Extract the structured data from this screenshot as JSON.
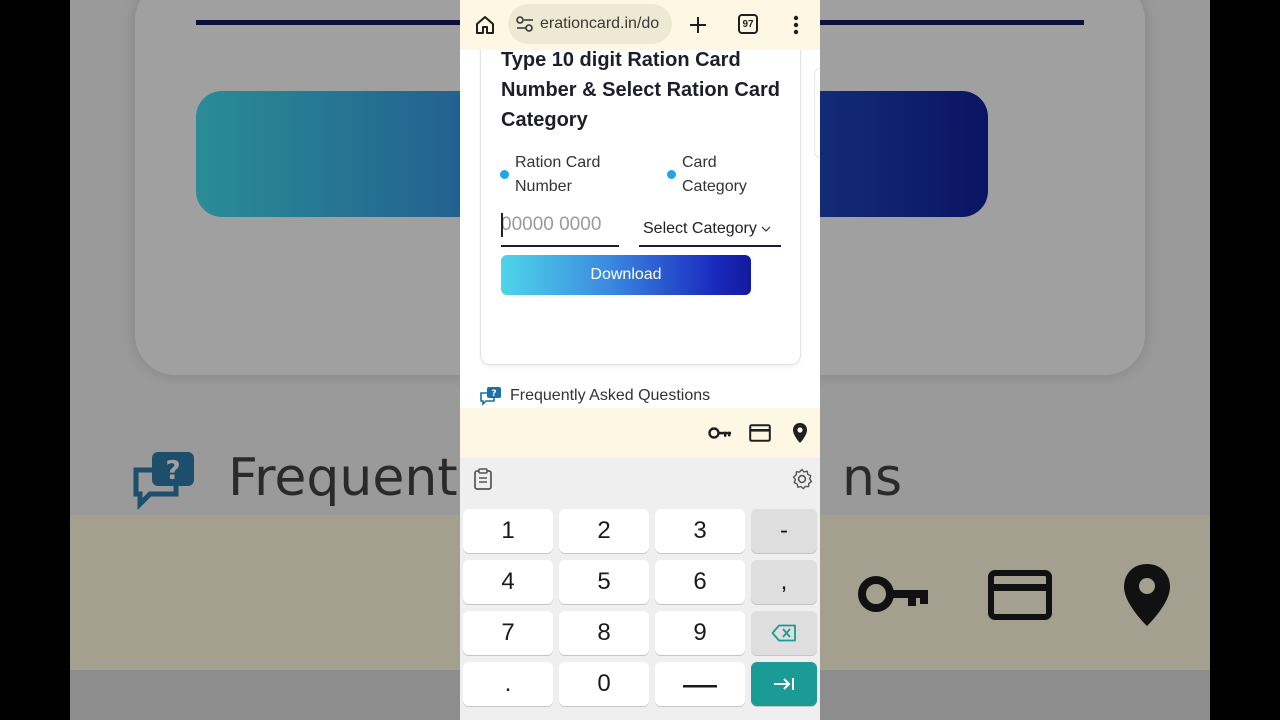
{
  "background": {
    "faq_text_partial_left": "Frequent",
    "faq_text_partial_right": "ns"
  },
  "browser": {
    "url": "erationcard.in/do",
    "tab_count": "97",
    "home_icon": "home-icon",
    "site_settings_icon": "tune-icon",
    "new_tab_icon": "plus-icon",
    "menu_icon": "more-vert-icon"
  },
  "form": {
    "title": "Type 10 digit Ration Card Number & Select Ration Card Category",
    "option_1_label": "Ration Card Number",
    "option_2_label": "Card Category",
    "ration_input_value": "",
    "ration_input_placeholder": "00000 0000",
    "category_select_value": "Select Category",
    "download_label": "Download",
    "accent_color": "#1ea7e8"
  },
  "faq": {
    "label": "Frequently Asked Questions"
  },
  "autofill_bar": {
    "icons": [
      "key-icon",
      "credit-card-icon",
      "location-pin-icon"
    ]
  },
  "keyboard": {
    "rows": [
      [
        "1",
        "2",
        "3",
        "-"
      ],
      [
        "4",
        "5",
        "6",
        ","
      ],
      [
        "7",
        "8",
        "9",
        "⌫"
      ],
      [
        ".",
        "0",
        "␣",
        "⇥"
      ]
    ],
    "action_color": "#1a9b96"
  }
}
